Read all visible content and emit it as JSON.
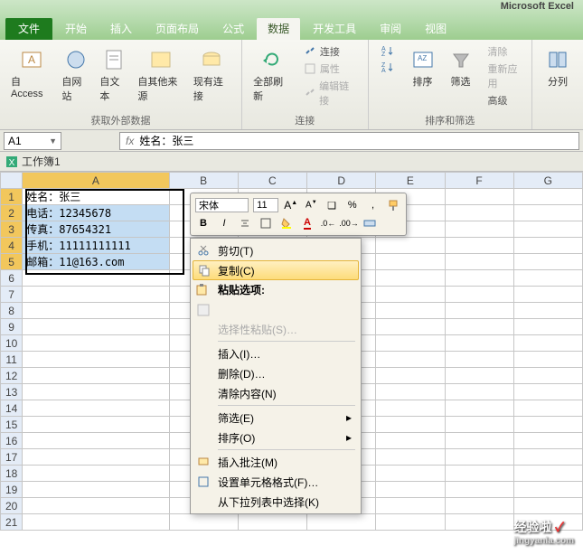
{
  "window": {
    "app_name": "Microsoft Excel"
  },
  "tabs": {
    "file": "文件",
    "items": [
      "开始",
      "插入",
      "页面布局",
      "公式",
      "数据",
      "开发工具",
      "审阅",
      "视图"
    ],
    "active_index": 4
  },
  "ribbon": {
    "group_external": {
      "access": "自 Access",
      "web": "自网站",
      "text": "自文本",
      "other": "自其他来源",
      "existing": "现有连接",
      "label": "获取外部数据"
    },
    "group_conn": {
      "refresh": "全部刷新",
      "link_conn": "连接",
      "link_prop": "属性",
      "link_edit": "编辑链接",
      "label": "连接"
    },
    "group_sort": {
      "sort": "排序",
      "filter": "筛选",
      "clear": "清除",
      "reapply": "重新应用",
      "advanced": "高级",
      "label": "排序和筛选"
    },
    "group_tools": {
      "ttc": "分列"
    }
  },
  "namebox": {
    "ref": "A1",
    "formula": "姓名：张三"
  },
  "workbook": {
    "title": "工作簿1"
  },
  "grid": {
    "cols": [
      "A",
      "B",
      "C",
      "D",
      "E",
      "F",
      "G"
    ],
    "rows": [
      "1",
      "2",
      "3",
      "4",
      "5",
      "6",
      "7",
      "8",
      "9",
      "10",
      "11",
      "12",
      "13",
      "14",
      "15",
      "16",
      "17",
      "18",
      "19",
      "20",
      "21"
    ],
    "data": {
      "A1": "姓名：张三",
      "A2": "电话：12345678",
      "A3": "传真：87654321",
      "A4": "手机：11111111111",
      "A5": "邮箱：11@163.com"
    }
  },
  "minitoolbar": {
    "font": "宋体",
    "size": "11"
  },
  "ctx": {
    "cut": "剪切(T)",
    "copy": "复制(C)",
    "paste_header": "粘贴选项:",
    "paste_special": "选择性粘贴(S)…",
    "insert": "插入(I)…",
    "delete": "删除(D)…",
    "clear": "清除内容(N)",
    "filter": "筛选(E)",
    "sort": "排序(O)",
    "comment": "插入批注(M)",
    "format": "设置单元格格式(F)…",
    "droplist": "从下拉列表中选择(K)"
  },
  "watermark": {
    "brand": "经验啦",
    "url": "jingyanla.com"
  }
}
